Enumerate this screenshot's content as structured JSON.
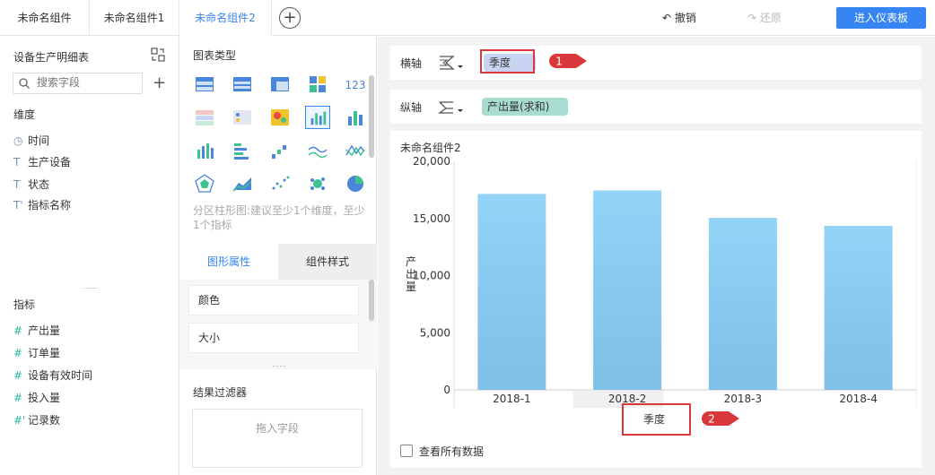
{
  "tabs": [
    {
      "label": "未命名组件"
    },
    {
      "label": "未命名组件1"
    },
    {
      "label": "未命名组件2"
    }
  ],
  "toolbar": {
    "undo_label": "撤销",
    "redo_label": "还原",
    "enter_label": "进入仪表板"
  },
  "left_panel": {
    "dataset_title": "设备生产明细表",
    "search_placeholder": "搜索字段",
    "dimension_label": "维度",
    "dimensions": [
      {
        "icon": "clock-icon",
        "label": "时间"
      },
      {
        "icon": "text-icon",
        "label": "生产设备"
      },
      {
        "icon": "text-icon",
        "label": "状态"
      },
      {
        "icon": "text-calc-icon",
        "label": "指标名称"
      }
    ],
    "measure_label": "指标",
    "measures": [
      {
        "icon": "hash-icon",
        "label": "产出量"
      },
      {
        "icon": "hash-icon",
        "label": "订单量"
      },
      {
        "icon": "hash-icon",
        "label": "设备有效时间"
      },
      {
        "icon": "hash-icon",
        "label": "投入量"
      },
      {
        "icon": "hash-calc-icon",
        "label": "记录数"
      }
    ]
  },
  "middle_panel": {
    "chart_type_title": "图表类型",
    "chart_hint": "分区柱形图:建议至少1个维度，至少1个指标",
    "tab_graph_props": "图形属性",
    "tab_component_style": "组件样式",
    "prop_color": "颜色",
    "prop_size": "大小",
    "filter_title": "结果过滤器",
    "filter_drop_hint": "拖入字段"
  },
  "axes": {
    "x_label": "横轴",
    "x_field": "季度",
    "y_label": "纵轴",
    "y_field": "产出量(求和)"
  },
  "callouts": [
    "1",
    "2"
  ],
  "chart_card": {
    "title": "未命名组件2",
    "show_all_label": "查看所有数据"
  },
  "chart_data": {
    "type": "bar",
    "categories": [
      "2018-1",
      "2018-2",
      "2018-3",
      "2018-4"
    ],
    "values": [
      17150,
      17450,
      15050,
      14350
    ],
    "xlabel": "季度",
    "ylabel": "产出量",
    "ylim": [
      0,
      20000
    ],
    "yticks": [
      "0",
      "5,000",
      "10,000",
      "15,000",
      "20,000"
    ],
    "yticks_values": [
      0,
      5000,
      10000,
      15000,
      20000
    ],
    "bar_color_top": "#93d3f6",
    "bar_color_bottom": "#7fbfe8"
  },
  "colors": {
    "accent": "#3685f2",
    "callout_red": "#d9383a"
  }
}
